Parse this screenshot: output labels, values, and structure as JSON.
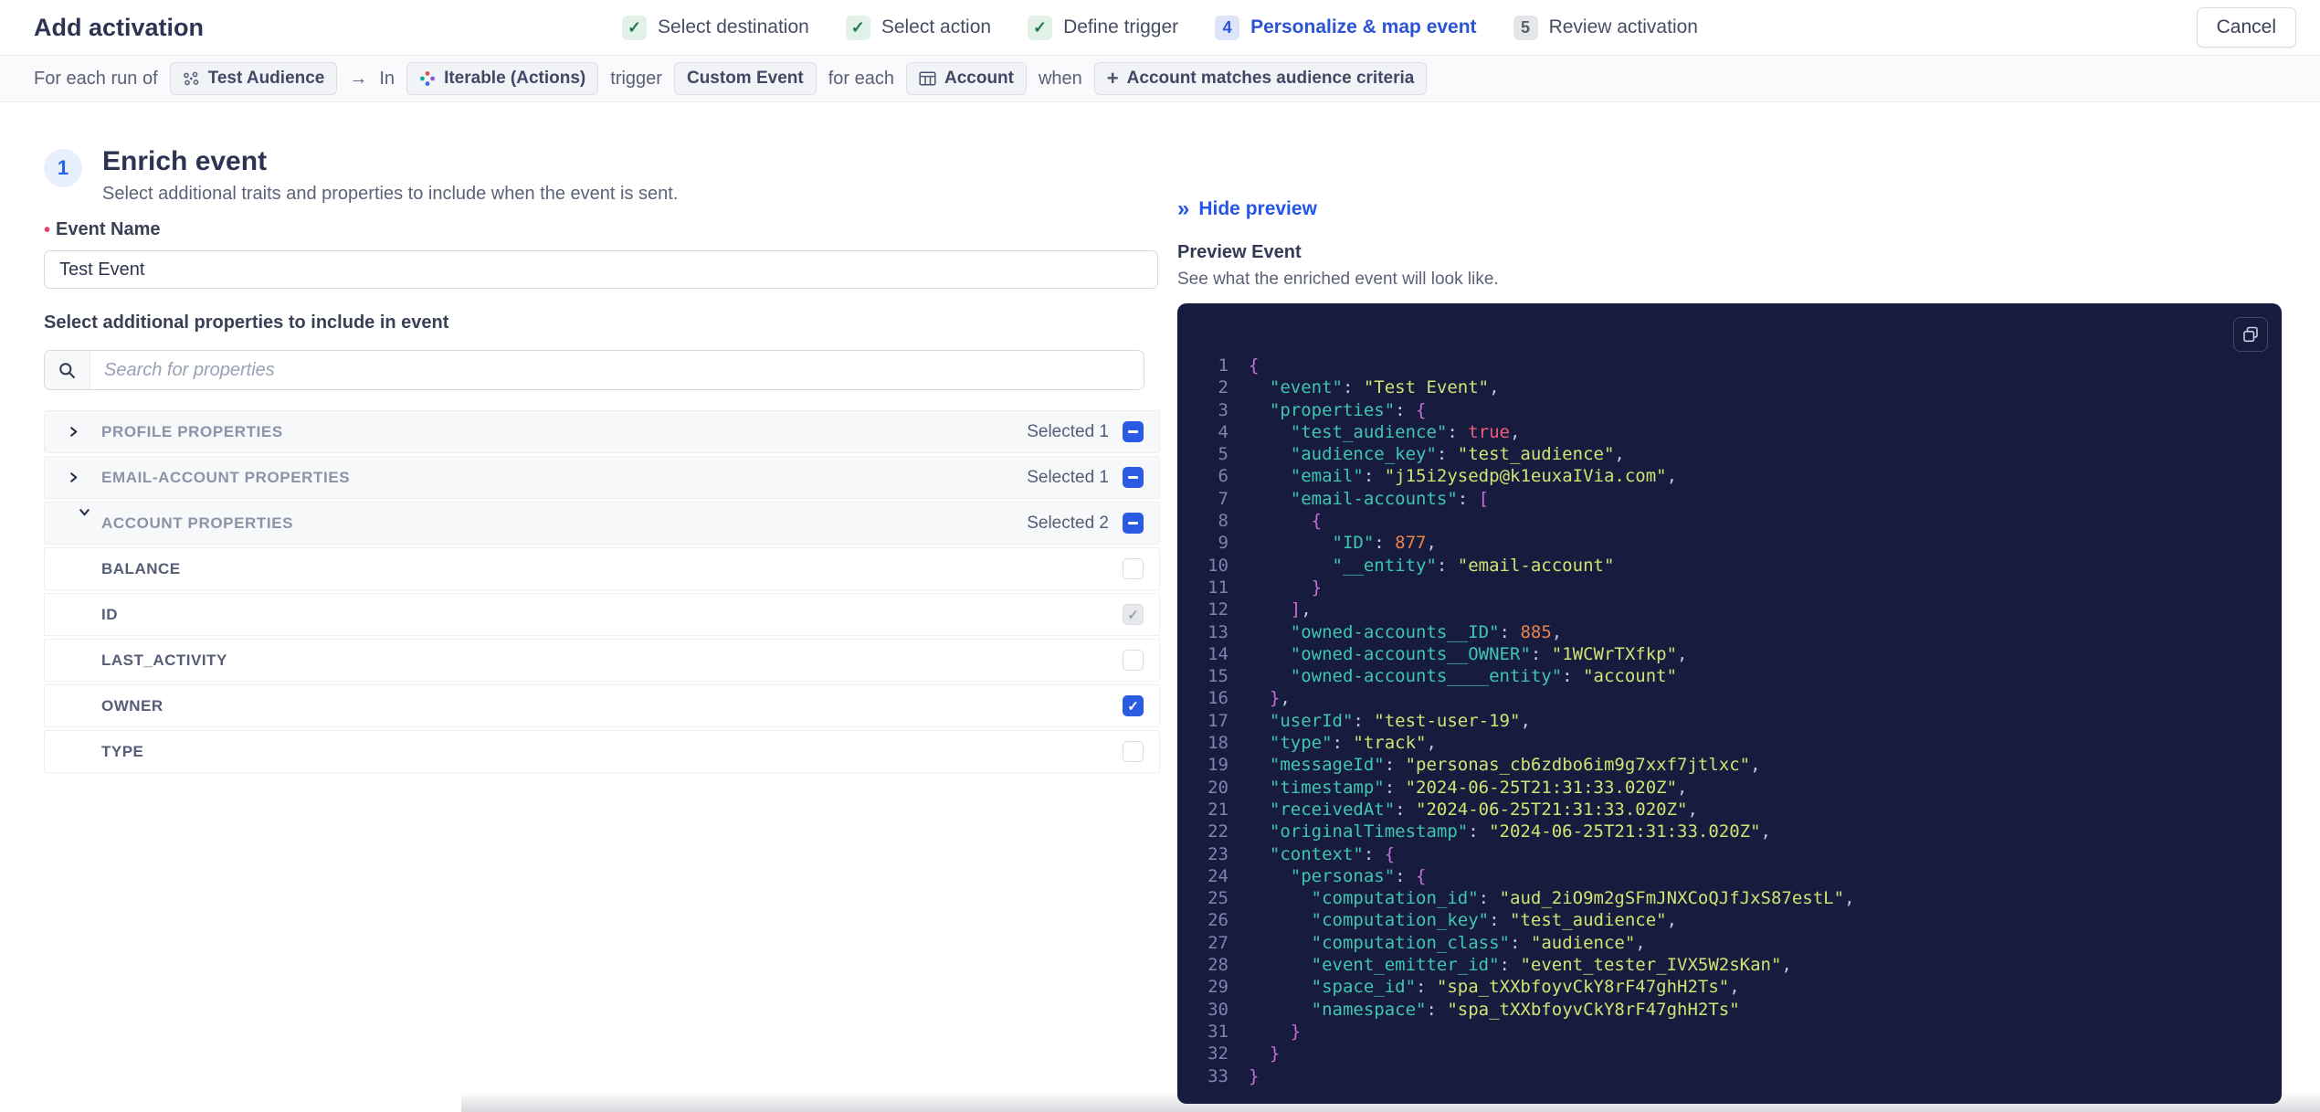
{
  "header": {
    "title": "Add activation",
    "cancel_label": "Cancel",
    "steps": [
      {
        "state": "done",
        "num": "",
        "label": "Select destination"
      },
      {
        "state": "done",
        "num": "",
        "label": "Select action"
      },
      {
        "state": "done",
        "num": "",
        "label": "Define trigger"
      },
      {
        "state": "active",
        "num": "4",
        "label": "Personalize & map event"
      },
      {
        "state": "todo",
        "num": "5",
        "label": "Review activation"
      }
    ]
  },
  "icons": {
    "check": "✓",
    "arrow_right": "→",
    "double_chevron": "»",
    "plus": "+",
    "required_marker": "•"
  },
  "breadcrumb": {
    "segments": [
      {
        "type": "text",
        "text": "For each run of"
      },
      {
        "type": "chip",
        "icon": "audience-icon",
        "text": "Test Audience"
      },
      {
        "type": "arrow",
        "text": "→"
      },
      {
        "type": "text",
        "text": "In"
      },
      {
        "type": "chip",
        "icon": "iterable-icon",
        "text": "Iterable (Actions)"
      },
      {
        "type": "text",
        "text": "trigger"
      },
      {
        "type": "chip",
        "icon": "",
        "text": "Custom Event"
      },
      {
        "type": "text",
        "text": "for each"
      },
      {
        "type": "chip",
        "icon": "table-icon",
        "text": "Account"
      },
      {
        "type": "text",
        "text": "when"
      },
      {
        "type": "chip",
        "icon": "plus-icon",
        "text": "Account matches audience criteria"
      }
    ]
  },
  "enrich": {
    "step_number": "1",
    "title": "Enrich event",
    "subtitle": "Select additional traits and properties to include when the event is sent.",
    "event_name": {
      "label": "Event Name",
      "value": "Test Event"
    },
    "properties_label": "Select additional properties to include in event",
    "search": {
      "placeholder": "Search for properties"
    }
  },
  "groups": [
    {
      "label": "PROFILE PROPERTIES",
      "selected": "Selected 1",
      "expanded": false,
      "items": []
    },
    {
      "label": "EMAIL-ACCOUNT PROPERTIES",
      "selected": "Selected 1",
      "expanded": false,
      "items": []
    },
    {
      "label": "ACCOUNT PROPERTIES",
      "selected": "Selected 2",
      "expanded": true,
      "items": [
        {
          "label": "BALANCE",
          "state": "unchecked"
        },
        {
          "label": "ID",
          "state": "checked-disabled"
        },
        {
          "label": "LAST_ACTIVITY",
          "state": "unchecked"
        },
        {
          "label": "OWNER",
          "state": "checked"
        },
        {
          "label": "TYPE",
          "state": "unchecked"
        }
      ]
    }
  ],
  "preview": {
    "hide_label": "Hide preview",
    "title": "Preview Event",
    "subtitle": "See what the enriched event will look like.",
    "code_lines": [
      [
        [
          "p",
          "{"
        ]
      ],
      [
        [
          "k",
          "  \"event\""
        ],
        [
          "o",
          ": "
        ],
        [
          "s",
          "\"Test Event\""
        ],
        [
          "o",
          ","
        ]
      ],
      [
        [
          "k",
          "  \"properties\""
        ],
        [
          "o",
          ": "
        ],
        [
          "p",
          "{"
        ]
      ],
      [
        [
          "k",
          "    \"test_audience\""
        ],
        [
          "o",
          ": "
        ],
        [
          "b",
          "true"
        ],
        [
          "o",
          ","
        ]
      ],
      [
        [
          "k",
          "    \"audience_key\""
        ],
        [
          "o",
          ": "
        ],
        [
          "s",
          "\"test_audience\""
        ],
        [
          "o",
          ","
        ]
      ],
      [
        [
          "k",
          "    \"email\""
        ],
        [
          "o",
          ": "
        ],
        [
          "s",
          "\"j15i2ysedp@k1euxaIVia.com\""
        ],
        [
          "o",
          ","
        ]
      ],
      [
        [
          "k",
          "    \"email-accounts\""
        ],
        [
          "o",
          ": "
        ],
        [
          "p",
          "["
        ]
      ],
      [
        [
          "p",
          "      {"
        ]
      ],
      [
        [
          "k",
          "        \"ID\""
        ],
        [
          "o",
          ": "
        ],
        [
          "n",
          "877"
        ],
        [
          "o",
          ","
        ]
      ],
      [
        [
          "k",
          "        \"__entity\""
        ],
        [
          "o",
          ": "
        ],
        [
          "s",
          "\"email-account\""
        ]
      ],
      [
        [
          "p",
          "      }"
        ]
      ],
      [
        [
          "p",
          "    ]"
        ],
        [
          "o",
          ","
        ]
      ],
      [
        [
          "k",
          "    \"owned-accounts__ID\""
        ],
        [
          "o",
          ": "
        ],
        [
          "n",
          "885"
        ],
        [
          "o",
          ","
        ]
      ],
      [
        [
          "k",
          "    \"owned-accounts__OWNER\""
        ],
        [
          "o",
          ": "
        ],
        [
          "s",
          "\"1WCWrTXfkp\""
        ],
        [
          "o",
          ","
        ]
      ],
      [
        [
          "k",
          "    \"owned-accounts____entity\""
        ],
        [
          "o",
          ": "
        ],
        [
          "s",
          "\"account\""
        ]
      ],
      [
        [
          "p",
          "  }"
        ],
        [
          "o",
          ","
        ]
      ],
      [
        [
          "k",
          "  \"userId\""
        ],
        [
          "o",
          ": "
        ],
        [
          "s",
          "\"test-user-19\""
        ],
        [
          "o",
          ","
        ]
      ],
      [
        [
          "k",
          "  \"type\""
        ],
        [
          "o",
          ": "
        ],
        [
          "s",
          "\"track\""
        ],
        [
          "o",
          ","
        ]
      ],
      [
        [
          "k",
          "  \"messageId\""
        ],
        [
          "o",
          ": "
        ],
        [
          "s",
          "\"personas_cb6zdbo6im9g7xxf7jtlxc\""
        ],
        [
          "o",
          ","
        ]
      ],
      [
        [
          "k",
          "  \"timestamp\""
        ],
        [
          "o",
          ": "
        ],
        [
          "s",
          "\"2024-06-25T21:31:33.020Z\""
        ],
        [
          "o",
          ","
        ]
      ],
      [
        [
          "k",
          "  \"receivedAt\""
        ],
        [
          "o",
          ": "
        ],
        [
          "s",
          "\"2024-06-25T21:31:33.020Z\""
        ],
        [
          "o",
          ","
        ]
      ],
      [
        [
          "k",
          "  \"originalTimestamp\""
        ],
        [
          "o",
          ": "
        ],
        [
          "s",
          "\"2024-06-25T21:31:33.020Z\""
        ],
        [
          "o",
          ","
        ]
      ],
      [
        [
          "k",
          "  \"context\""
        ],
        [
          "o",
          ": "
        ],
        [
          "p",
          "{"
        ]
      ],
      [
        [
          "k",
          "    \"personas\""
        ],
        [
          "o",
          ": "
        ],
        [
          "p",
          "{"
        ]
      ],
      [
        [
          "k",
          "      \"computation_id\""
        ],
        [
          "o",
          ": "
        ],
        [
          "s",
          "\"aud_2iO9m2gSFmJNXCoQJfJxS87estL\""
        ],
        [
          "o",
          ","
        ]
      ],
      [
        [
          "k",
          "      \"computation_key\""
        ],
        [
          "o",
          ": "
        ],
        [
          "s",
          "\"test_audience\""
        ],
        [
          "o",
          ","
        ]
      ],
      [
        [
          "k",
          "      \"computation_class\""
        ],
        [
          "o",
          ": "
        ],
        [
          "s",
          "\"audience\""
        ],
        [
          "o",
          ","
        ]
      ],
      [
        [
          "k",
          "      \"event_emitter_id\""
        ],
        [
          "o",
          ": "
        ],
        [
          "s",
          "\"event_tester_IVX5W2sKan\""
        ],
        [
          "o",
          ","
        ]
      ],
      [
        [
          "k",
          "      \"space_id\""
        ],
        [
          "o",
          ": "
        ],
        [
          "s",
          "\"spa_tXXbfoyvCkY8rF47ghH2Ts\""
        ],
        [
          "o",
          ","
        ]
      ],
      [
        [
          "k",
          "      \"namespace\""
        ],
        [
          "o",
          ": "
        ],
        [
          "s",
          "\"spa_tXXbfoyvCkY8rF47ghH2Ts\""
        ]
      ],
      [
        [
          "p",
          "    }"
        ]
      ],
      [
        [
          "p",
          "  }"
        ]
      ],
      [
        [
          "p",
          "}"
        ]
      ]
    ]
  },
  "colors": {
    "accent_blue": "#2a5be2",
    "active_step_blue": "#2b53d6",
    "done_green": "#1d7a4b",
    "code_bg": "#171b3e",
    "code_key": "#3fc6b3",
    "code_string": "#cfe473",
    "code_number": "#e8854d",
    "code_bool": "#ef5f78",
    "code_brace": "#c76fd6",
    "required_red": "#e04a69"
  }
}
